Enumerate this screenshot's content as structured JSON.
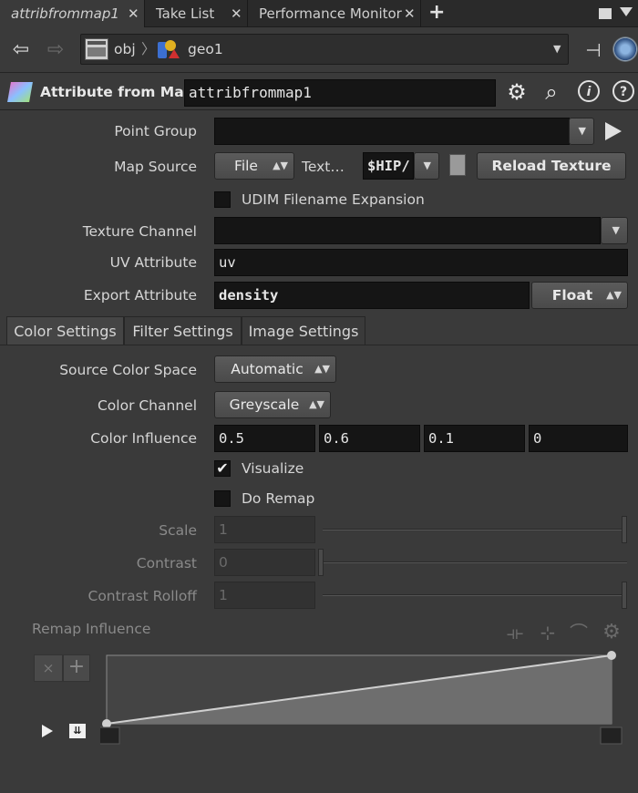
{
  "tabs": [
    {
      "label": "attribfrommap1",
      "active": true
    },
    {
      "label": "Take List",
      "active": false
    },
    {
      "label": "Performance Monitor",
      "active": false
    }
  ],
  "tab_close_glyph": "✕",
  "add_tab_glyph": "+",
  "path": {
    "segments": [
      "obj",
      "geo1"
    ]
  },
  "node": {
    "type_label": "Attribute from Map",
    "name": "attribfrommap1"
  },
  "params": {
    "point_group": {
      "label": "Point Group",
      "value": ""
    },
    "map_source": {
      "label": "Map Source",
      "menu_value": "File",
      "texture_label": "Text…",
      "texture_value": "$HIP/",
      "reload_label": "Reload Texture"
    },
    "udim": {
      "label": "UDIM Filename Expansion",
      "checked": false
    },
    "texture_channel": {
      "label": "Texture Channel",
      "value": ""
    },
    "uv_attribute": {
      "label": "UV Attribute",
      "value": "uv"
    },
    "export_attribute": {
      "label": "Export Attribute",
      "value": "density",
      "type_value": "Float"
    }
  },
  "param_tabs": [
    "Color Settings",
    "Filter Settings",
    "Image Settings"
  ],
  "color": {
    "source_color_space": {
      "label": "Source Color Space",
      "value": "Automatic"
    },
    "color_channel": {
      "label": "Color Channel",
      "value": "Greyscale"
    },
    "color_influence": {
      "label": "Color Influence",
      "values": [
        "0.5",
        "0.6",
        "0.1",
        "0"
      ]
    },
    "visualize": {
      "label": "Visualize",
      "checked": true
    },
    "do_remap": {
      "label": "Do Remap",
      "checked": false
    },
    "scale": {
      "label": "Scale",
      "value": "1",
      "fraction": 1.0
    },
    "contrast": {
      "label": "Contrast",
      "value": "0",
      "fraction": 0.0
    },
    "contrast_rolloff": {
      "label": "Contrast Rolloff",
      "value": "1",
      "fraction": 1.0
    },
    "remap_influence": {
      "label": "Remap Influence",
      "points": [
        [
          0,
          0
        ],
        [
          1,
          1
        ]
      ]
    }
  },
  "colors": {
    "accent": "#d6d6d6",
    "field_bg": "#151515",
    "panel_bg": "#3a3a3a"
  }
}
